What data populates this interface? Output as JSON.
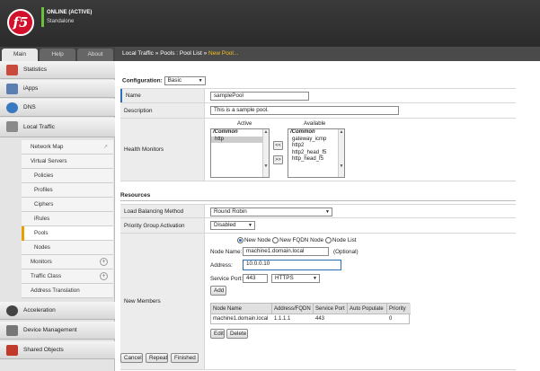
{
  "header": {
    "status": "ONLINE (ACTIVE)",
    "mode": "Standalone",
    "logo_text": "f5",
    "status_color": "#6cbf3a",
    "brand_color": "#d3102b"
  },
  "tabs": [
    {
      "label": "Main",
      "active": true
    },
    {
      "label": "Help",
      "active": false
    },
    {
      "label": "About",
      "active": false
    }
  ],
  "breadcrumb": {
    "part1": "Local Traffic",
    "sep": "»",
    "part2": "Pools : Pool List",
    "current": "New Pool..."
  },
  "sidebar": {
    "sections": [
      {
        "label": "Statistics",
        "icon": "statistics-icon"
      },
      {
        "label": "iApps",
        "icon": "iapps-icon"
      },
      {
        "label": "DNS",
        "icon": "dns-icon"
      },
      {
        "label": "Local Traffic",
        "icon": "local-traffic-icon"
      },
      {
        "label": "Acceleration",
        "icon": "acceleration-icon"
      },
      {
        "label": "Device Management",
        "icon": "device-management-icon"
      },
      {
        "label": "Shared Objects",
        "icon": "shared-objects-icon"
      }
    ],
    "items": [
      {
        "label": "Network Map"
      },
      {
        "label": "Virtual Servers"
      },
      {
        "label": "Policies"
      },
      {
        "label": "Profiles"
      },
      {
        "label": "Ciphers"
      },
      {
        "label": "iRules"
      },
      {
        "label": "Pools"
      },
      {
        "label": "Nodes"
      },
      {
        "label": "Monitors"
      },
      {
        "label": "Traffic Class"
      },
      {
        "label": "Address Translation"
      }
    ],
    "accent": "#e8a000"
  },
  "form": {
    "configuration_label": "Configuration:",
    "configuration_value": "Basic",
    "name_label": "Name",
    "name_value": "samplePool",
    "description_label": "Description",
    "description_value": "This is a sample pool.",
    "health_label": "Health Monitors",
    "active_label": "Active",
    "available_label": "Available",
    "active_group": "/Common",
    "active_items": [
      "http"
    ],
    "available_group": "/Common",
    "available_items": [
      "gateway_icmp",
      "http2",
      "http2_head_f5",
      "http_head_f5"
    ],
    "move_left": "<<",
    "move_right": ">>",
    "resources_label": "Resources",
    "lb_label": "Load Balancing Method",
    "lb_value": "Round Robin",
    "pga_label": "Priority Group Activation",
    "pga_value": "Disabled",
    "members_label": "New Members",
    "radio_new_node": "New Node",
    "radio_fqdn": "New FQDN Node",
    "radio_list": "Node List",
    "node_name_label": "Node Name:",
    "node_name_value": "machine1.domain.local",
    "optional": "(Optional)",
    "address_label": "Address:",
    "address_value": "10.0.0.10",
    "port_label": "Service Port:",
    "port_value": "443",
    "port_service": "HTTPS",
    "add_button": "Add",
    "members_table": {
      "headers": [
        "Node Name",
        "Address/FQDN",
        "Service Port",
        "Auto Populate",
        "Priority"
      ],
      "rows": [
        [
          "machine1.domain.local",
          "1.1.1.1",
          "443",
          "",
          "0"
        ]
      ]
    },
    "edit_button": "Edit",
    "delete_button": "Delete"
  },
  "actions": {
    "cancel": "Cancel",
    "repeat": "Repeat",
    "finished": "Finished"
  }
}
